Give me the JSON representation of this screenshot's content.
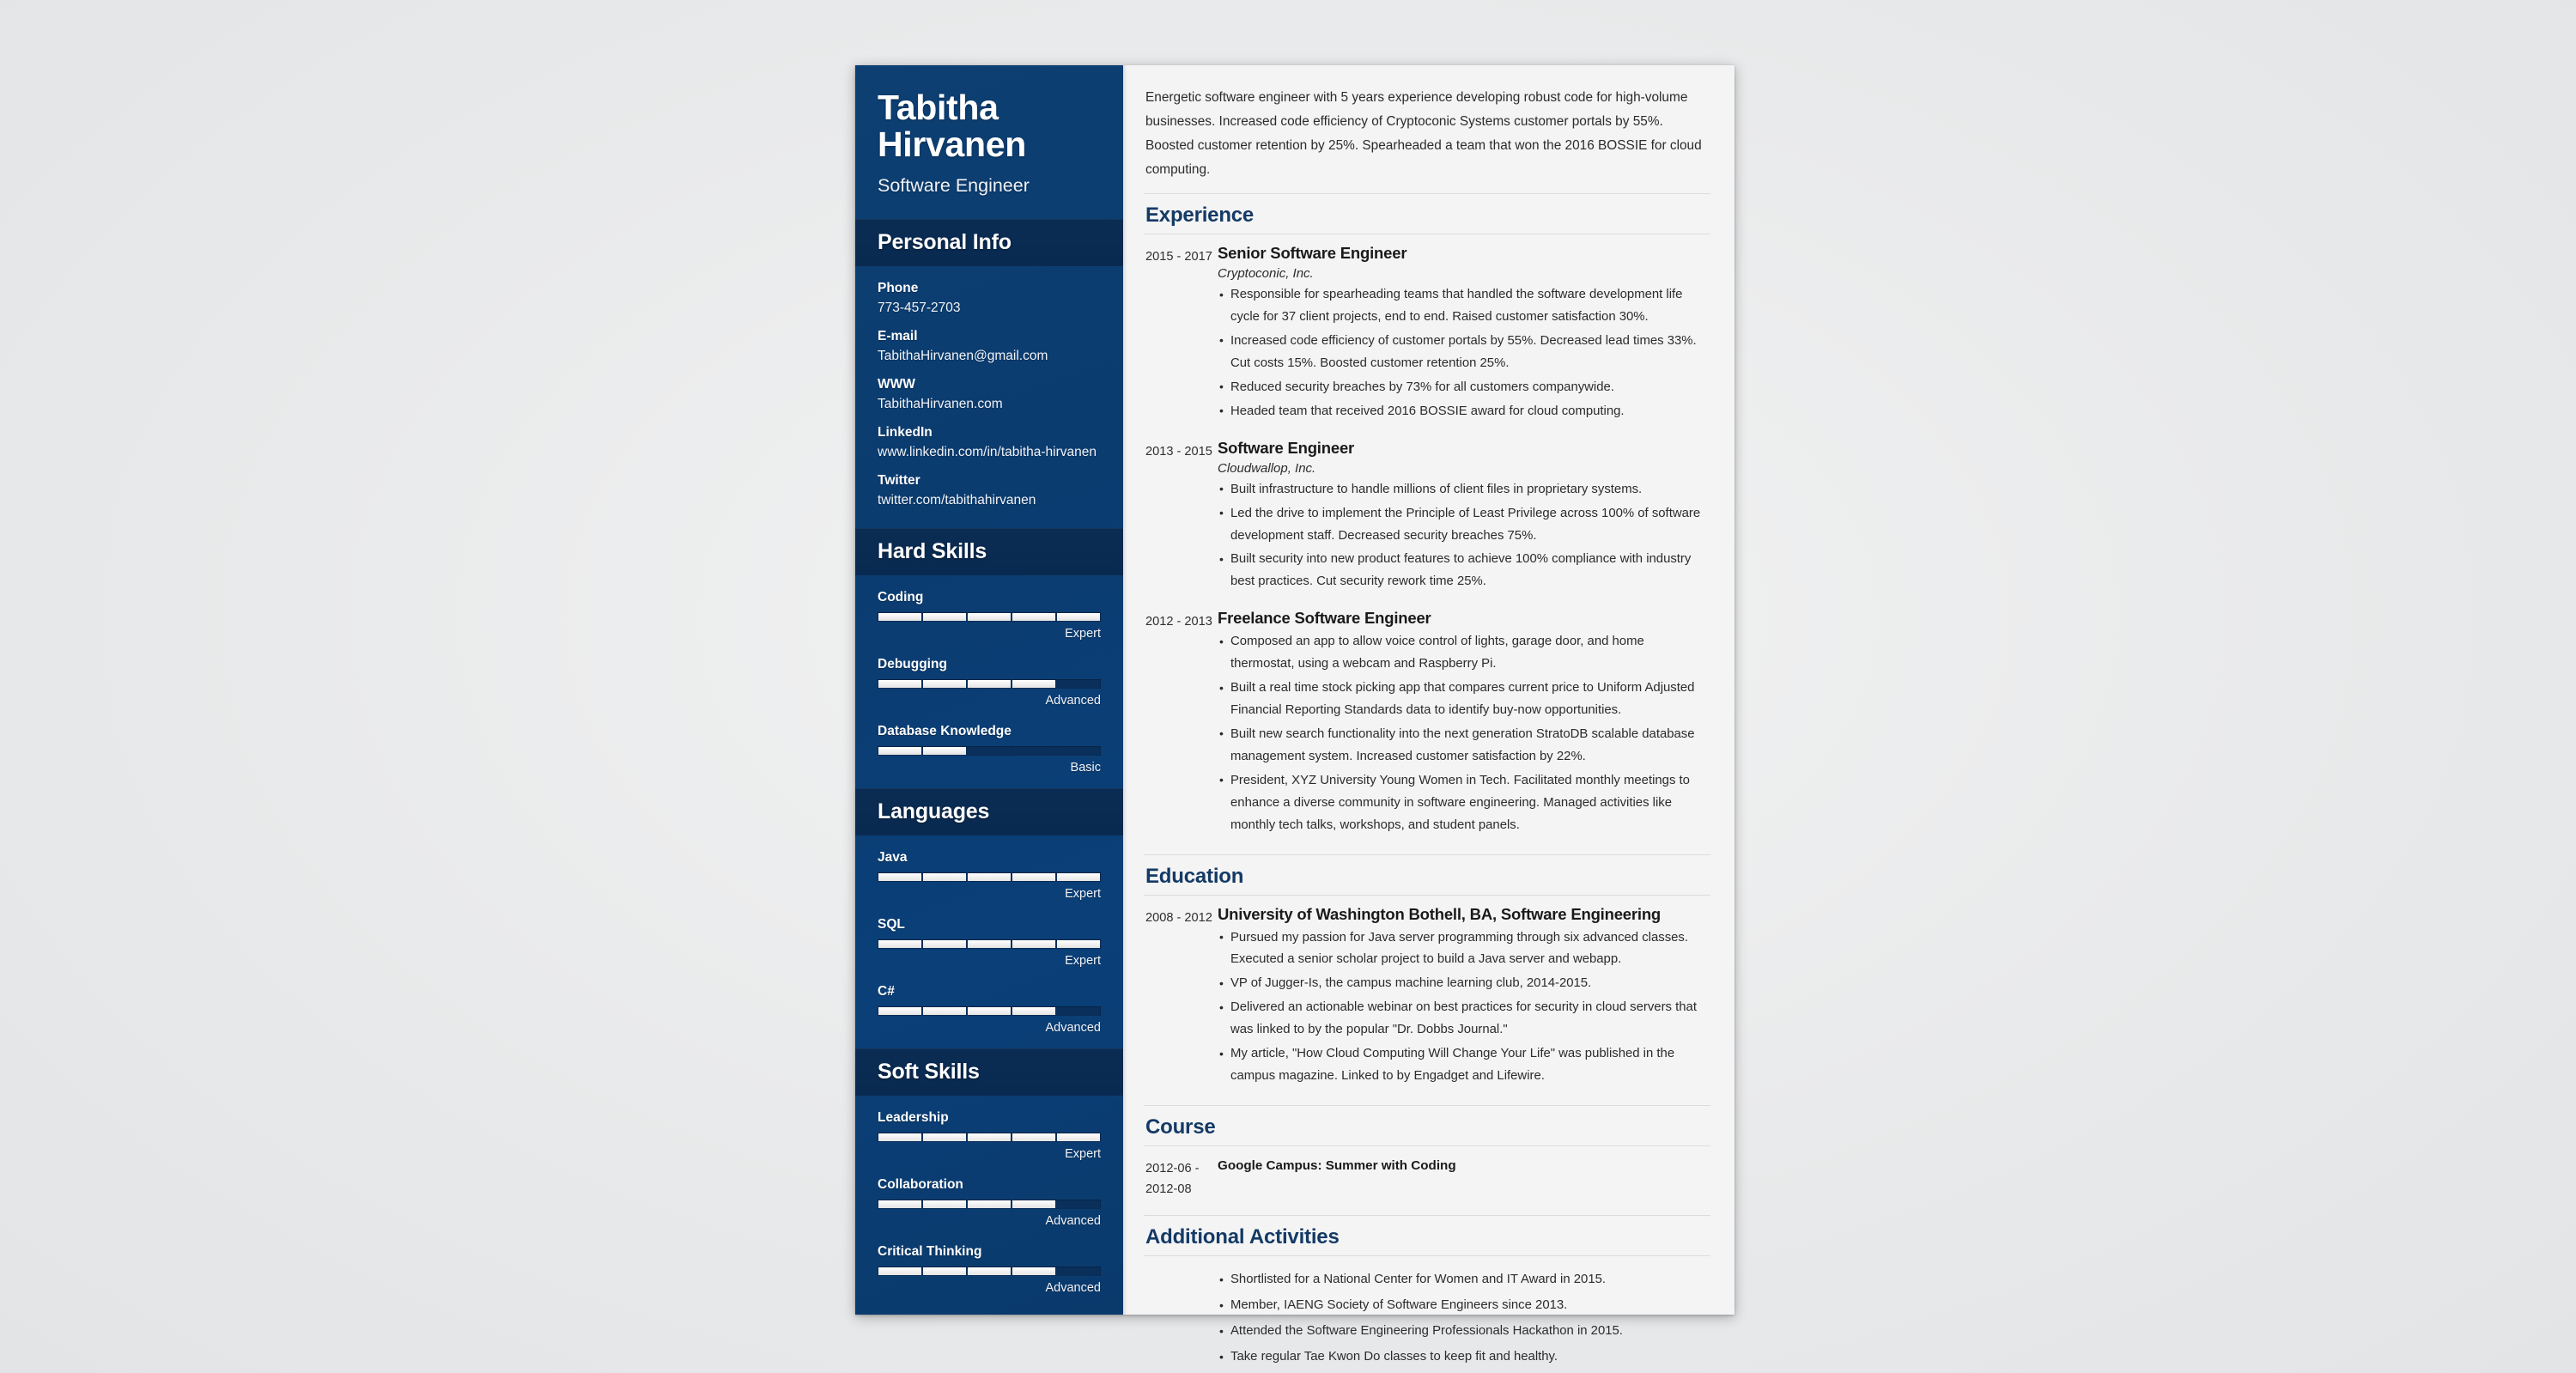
{
  "sidebar": {
    "name": "Tabitha Hirvanen",
    "job_title": "Software Engineer",
    "personal_info": {
      "heading": "Personal Info",
      "items": [
        {
          "label": "Phone",
          "value": "773-457-2703"
        },
        {
          "label": "E-mail",
          "value": "TabithaHirvanen@gmail.com"
        },
        {
          "label": "WWW",
          "value": "TabithaHirvanen.com"
        },
        {
          "label": "LinkedIn",
          "value": "www.linkedin.com/in/tabitha-hirvanen"
        },
        {
          "label": "Twitter",
          "value": "twitter.com/tabithahirvanen"
        }
      ]
    },
    "hard_skills": {
      "heading": "Hard Skills",
      "items": [
        {
          "name": "Coding",
          "level": "Expert",
          "filled": 5
        },
        {
          "name": "Debugging",
          "level": "Advanced",
          "filled": 4
        },
        {
          "name": "Database Knowledge",
          "level": "Basic",
          "filled": 2
        }
      ]
    },
    "languages": {
      "heading": "Languages",
      "items": [
        {
          "name": "Java",
          "level": "Expert",
          "filled": 5
        },
        {
          "name": "SQL",
          "level": "Expert",
          "filled": 5
        },
        {
          "name": "C#",
          "level": "Advanced",
          "filled": 4
        }
      ]
    },
    "soft_skills": {
      "heading": "Soft Skills",
      "items": [
        {
          "name": "Leadership",
          "level": "Expert",
          "filled": 5
        },
        {
          "name": "Collaboration",
          "level": "Advanced",
          "filled": 4
        },
        {
          "name": "Critical Thinking",
          "level": "Advanced",
          "filled": 4
        }
      ]
    },
    "bar_segments": 5
  },
  "main": {
    "summary": "Energetic software engineer with 5 years experience developing robust code for high-volume businesses. Increased code efficiency of Cryptoconic Systems customer portals by 55%. Boosted customer retention by 25%. Spearheaded a team that won the 2016 BOSSIE for cloud computing.",
    "experience": {
      "heading": "Experience",
      "entries": [
        {
          "dates": "2015 - 2017",
          "role": "Senior Software Engineer",
          "company": "Cryptoconic, Inc.",
          "bullets": [
            "Responsible for spearheading teams that handled the software development life cycle for 37 client projects, end to end. Raised customer satisfaction 30%.",
            "Increased code efficiency of customer portals by 55%. Decreased lead times 33%. Cut costs 15%. Boosted customer retention 25%.",
            "Reduced security breaches by 73% for all customers companywide.",
            "Headed team that received 2016 BOSSIE award for cloud computing."
          ]
        },
        {
          "dates": "2013 - 2015",
          "role": "Software Engineer",
          "company": "Cloudwallop, Inc.",
          "bullets": [
            "Built infrastructure to handle millions of client files in proprietary systems.",
            "Led the drive to implement the Principle of Least Privilege across 100% of software development staff. Decreased security breaches 75%.",
            "Built security into new product features to achieve 100% compliance with industry best practices. Cut security rework time 25%."
          ]
        },
        {
          "dates": "2012 - 2013",
          "role": "Freelance Software Engineer",
          "company": "",
          "bullets": [
            "Composed an app to allow voice control of lights, garage door, and home thermostat, using a webcam and Raspberry Pi.",
            "Built a real time stock picking app that compares current price to Uniform Adjusted Financial Reporting Standards data to identify buy-now opportunities.",
            "Built new search functionality into the next generation StratoDB scalable database management system. Increased customer satisfaction by 22%.",
            "President, XYZ University Young Women in Tech. Facilitated monthly meetings to enhance a diverse community in software engineering. Managed activities like monthly tech talks, workshops, and student panels."
          ]
        }
      ]
    },
    "education": {
      "heading": "Education",
      "entries": [
        {
          "dates": "2008 - 2012",
          "role": "University of Washington Bothell, BA, Software Engineering",
          "company": "",
          "bullets": [
            "Pursued my passion for Java server programming through six advanced classes. Executed a senior scholar project to build a Java server and webapp.",
            "VP of Jugger-Is, the campus machine learning club, 2014-2015.",
            "Delivered an actionable webinar on best practices for security in cloud servers that was linked to by the popular \"Dr. Dobbs Journal.\"",
            "My article, \"How Cloud Computing Will Change Your Life\" was published in the campus magazine. Linked to by Engadget and Lifewire."
          ]
        }
      ]
    },
    "course": {
      "heading": "Course",
      "entries": [
        {
          "dates": "2012-06 - 2012-08",
          "title": "Google Campus: Summer with Coding"
        }
      ]
    },
    "additional_activities": {
      "heading": "Additional Activities",
      "bullets": [
        "Shortlisted for a National Center for Women and IT Award in 2015.",
        "Member, IAENG Society of Software Engineers since 2013.",
        "Attended the Software Engineering Professionals Hackathon in 2015.",
        "Take regular Tae Kwon Do classes to keep fit and healthy."
      ]
    }
  },
  "colors": {
    "sidebar_blue": "#0b3c70",
    "sidebar_header_band": "#0a2c53",
    "heading_navy": "#143a66",
    "page_bg": "#f4f4f4",
    "canvas_bg": "#eceded"
  }
}
